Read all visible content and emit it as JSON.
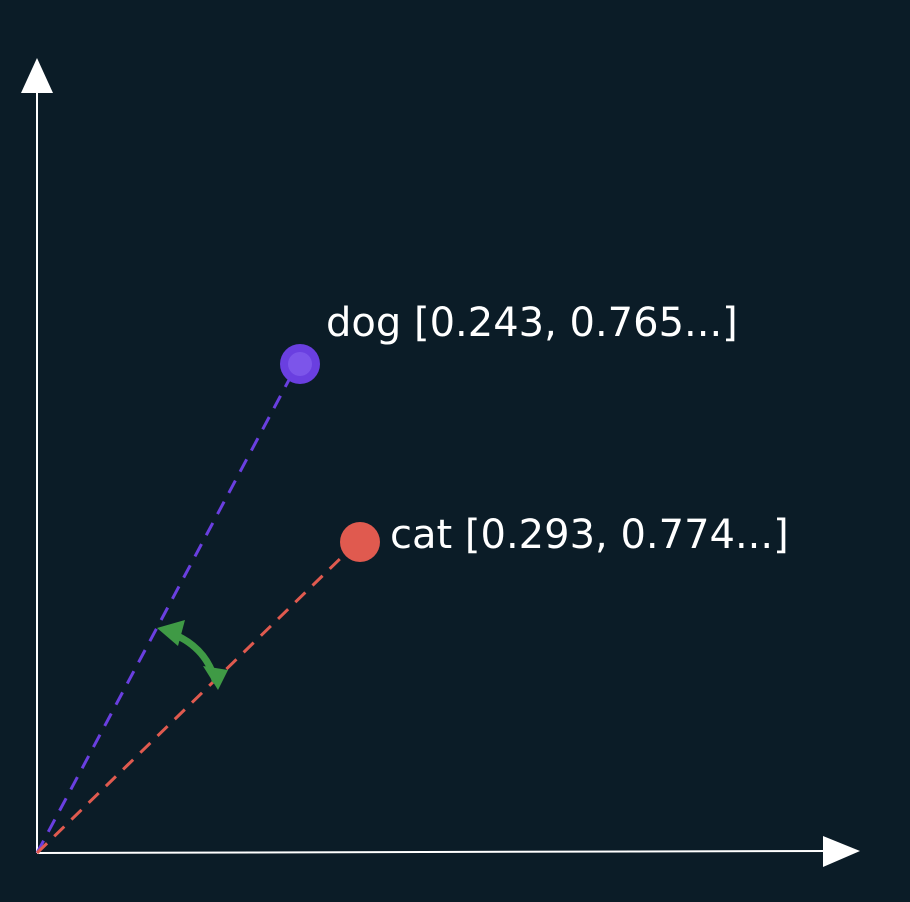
{
  "colors": {
    "background": "#0b1c27",
    "axes": "#ffffff",
    "dog": "#6a3fe0",
    "cat": "#e05a4f",
    "angle_arrow": "#3f9a45",
    "text": "#ffffff"
  },
  "points": [
    {
      "id": "dog",
      "label": "dog [0.243, 0.765...]"
    },
    {
      "id": "cat",
      "label": "cat [0.293, 0.774...]"
    }
  ]
}
